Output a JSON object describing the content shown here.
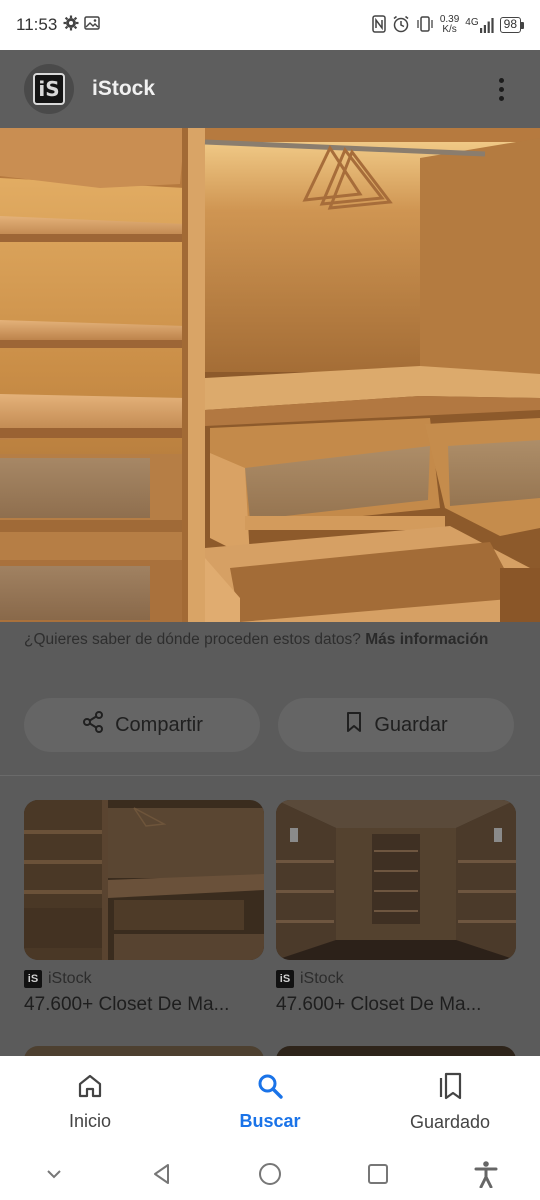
{
  "status_bar": {
    "time": "11:53",
    "net_speed_value": "0.39",
    "net_speed_unit": "K/s",
    "network_type": "4G",
    "battery": "98"
  },
  "header": {
    "site_name": "iStock"
  },
  "info": {
    "source_question": "¿Quieres saber de dónde proceden estos datos?",
    "more_info_link": "Más información"
  },
  "actions": {
    "share_label": "Compartir",
    "save_label": "Guardar"
  },
  "results": [
    {
      "source": "iStock",
      "title": "47.600+ Closet De Ma..."
    },
    {
      "source": "iStock",
      "title": "47.600+ Closet De Ma..."
    }
  ],
  "bottom_nav": {
    "home_label": "Inicio",
    "search_label": "Buscar",
    "saved_label": "Guardado"
  },
  "colors": {
    "accent": "#1a73e8",
    "overlay": "#5b5b5b"
  }
}
